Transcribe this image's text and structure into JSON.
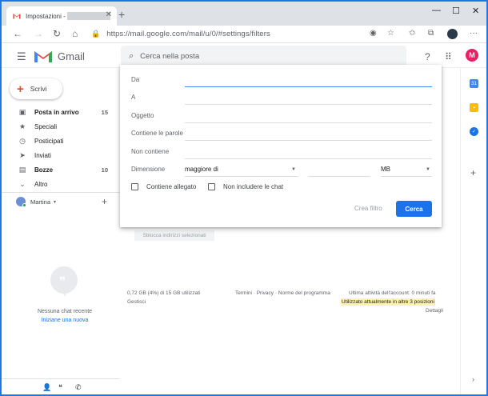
{
  "browser": {
    "tab_title": "Impostazioni -",
    "url": "https://mail.google.com/mail/u/0/#settings/filters",
    "newtab_icon": "plus-icon",
    "window_controls": [
      "minimize-icon",
      "maximize-icon",
      "close-icon"
    ]
  },
  "gmail": {
    "app_name": "Gmail",
    "search_placeholder": "Cerca nella posta",
    "avatar_letter": "M",
    "avatar_color": "#e91e63",
    "compose_label": "Scrivi"
  },
  "sidebar": {
    "items": [
      {
        "label": "Posta in arrivo",
        "count": "15",
        "bold": true,
        "icon": "inbox-icon"
      },
      {
        "label": "Speciali",
        "count": "",
        "bold": false,
        "icon": "star-icon"
      },
      {
        "label": "Posticipati",
        "count": "",
        "bold": false,
        "icon": "clock-icon"
      },
      {
        "label": "Inviati",
        "count": "",
        "bold": false,
        "icon": "send-icon"
      },
      {
        "label": "Bozze",
        "count": "10",
        "bold": true,
        "icon": "draft-icon"
      },
      {
        "label": "Altro",
        "count": "",
        "bold": false,
        "icon": "chevron-down-icon"
      }
    ],
    "user_name": "Martina",
    "no_chat_text": "Nessuna chat recente",
    "start_chat_link": "Iniziane una nuova"
  },
  "search_panel": {
    "fields": [
      {
        "label": "Da",
        "value": ""
      },
      {
        "label": "A",
        "value": ""
      },
      {
        "label": "Oggetto",
        "value": ""
      },
      {
        "label": "Contiene le parole",
        "value": ""
      },
      {
        "label": "Non contiene",
        "value": ""
      }
    ],
    "size_label": "Dimensione",
    "size_operator": "maggiore di",
    "size_value": "",
    "size_unit": "MB",
    "has_attachment_label": "Contiene allegato",
    "exclude_chats_label": "Non includere le chat",
    "create_filter_label": "Crea filtro",
    "search_button_label": "Cerca"
  },
  "main": {
    "unblock_button": "Sblocca indirizzi selezionati",
    "storage_text": "0,72 GB (4%) di 15 GB utilizzati",
    "manage_link": "Gestisci",
    "footer_links": "Termini · Privacy · Norme del programma",
    "last_activity": "Ultima attività dell'account: 0 minuti fa",
    "current_usage": "Utilizzato attualmente in altre 3 posizioni",
    "details_link": "Dettagli"
  }
}
